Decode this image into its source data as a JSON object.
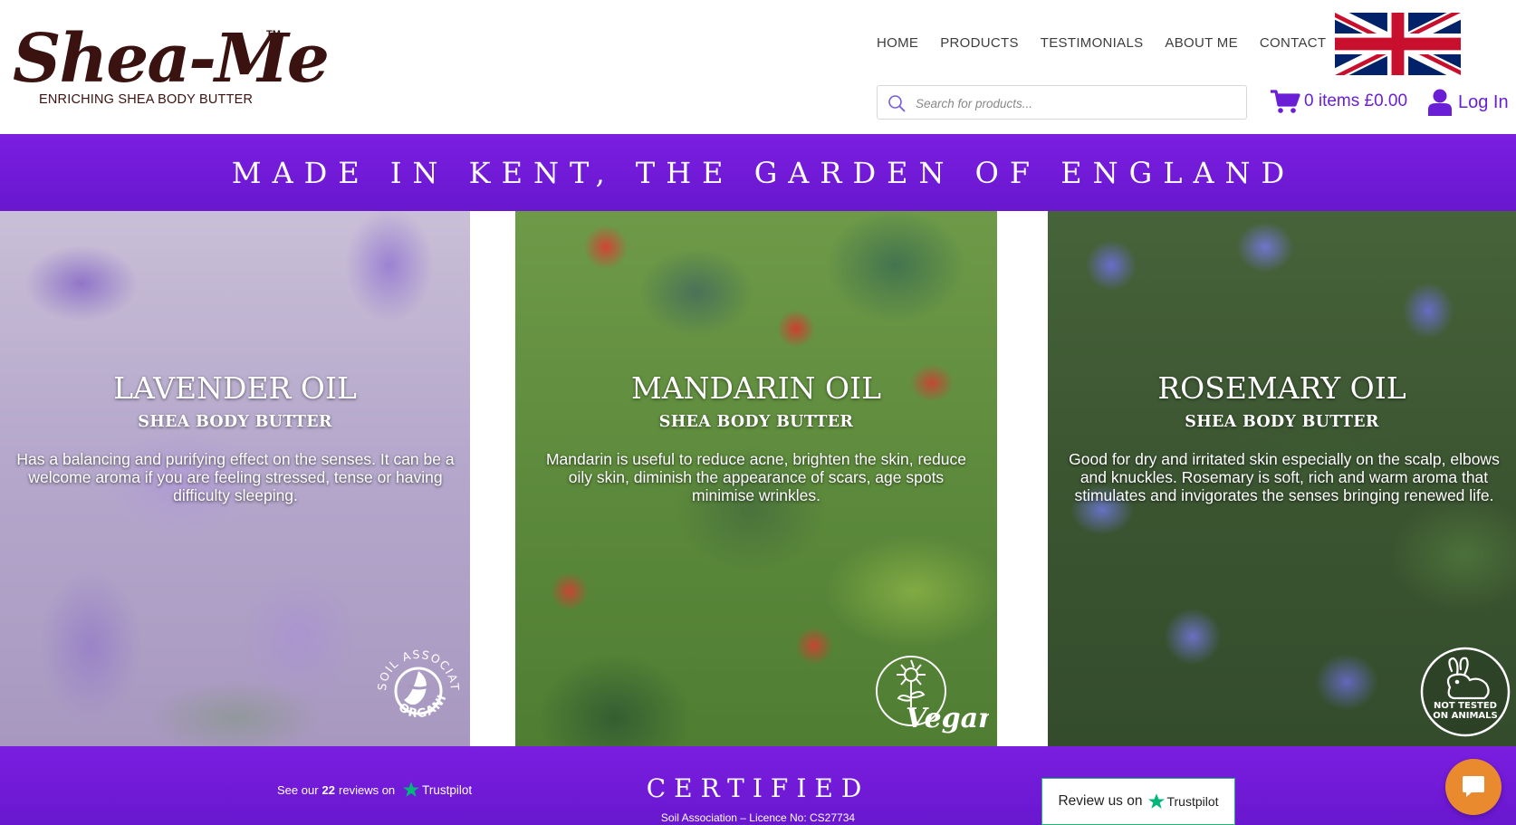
{
  "brand": {
    "logo_text": "Shea-Me",
    "trademark": "TM",
    "tagline": "ENRICHING SHEA BODY BUTTER"
  },
  "nav": {
    "items": [
      {
        "label": "HOME"
      },
      {
        "label": "PRODUCTS"
      },
      {
        "label": "TESTIMONIALS"
      },
      {
        "label": "ABOUT ME"
      },
      {
        "label": "CONTACT"
      }
    ]
  },
  "search": {
    "placeholder": "Search for products...",
    "value": ""
  },
  "cart": {
    "summary": "0 items £0.00"
  },
  "account": {
    "login_label": "Log In"
  },
  "banner": {
    "text": "MADE IN KENT, THE GARDEN OF ENGLAND"
  },
  "panels": [
    {
      "title": "LAVENDER OIL",
      "subtitle": "SHEA BODY BUTTER",
      "description": "Has a balancing and purifying effect on the senses. It can be a welcome aroma if you are feeling stressed, tense or having difficulty sleeping.",
      "badge": {
        "icon": "soil-association-organic-icon",
        "text_top": "SOIL ASSOCIATION",
        "text_bottom": "ORGANIC"
      }
    },
    {
      "title": "MANDARIN OIL",
      "subtitle": "SHEA BODY BUTTER",
      "description": "Mandarin is useful to reduce acne, brighten the skin, reduce oily skin, diminish the appearance of scars, age spots minimise wrinkles.",
      "badge": {
        "icon": "vegan-sunflower-icon",
        "text": "Vegan"
      }
    },
    {
      "title": "ROSEMARY OIL",
      "subtitle": "SHEA BODY BUTTER",
      "description": "Good for dry and irritated skin especially on the scalp, elbows and knuckles. Rosemary is soft, rich and warm aroma that stimulates and invigorates the senses bringing renewed life.",
      "badge": {
        "icon": "not-tested-on-animals-rabbit-icon",
        "line1": "NOT TESTED",
        "line2": "ON ANIMALS"
      }
    }
  ],
  "footer": {
    "reviews_prefix": "See our",
    "reviews_count": "22",
    "reviews_suffix": "reviews on",
    "trustpilot": "Trustpilot",
    "certified": "CERTIFIED",
    "licence": "Soil Association – Licence No: CS27734",
    "review_button_label": "Review us on",
    "review_button_brand": "Trustpilot"
  },
  "colors": {
    "accent_purple": "#6a1fd6",
    "banner_purple": "#7a1ee0",
    "logo_brown": "#3a1210",
    "trustpilot_green": "#00b67a",
    "chat_orange": "#ea8a2f"
  },
  "icons": {
    "flag": "uk-flag-icon",
    "search": "search-icon",
    "cart": "cart-icon",
    "user": "user-icon",
    "chat": "chat-bubble-icon",
    "trustpilot_star": "trustpilot-star-icon"
  }
}
